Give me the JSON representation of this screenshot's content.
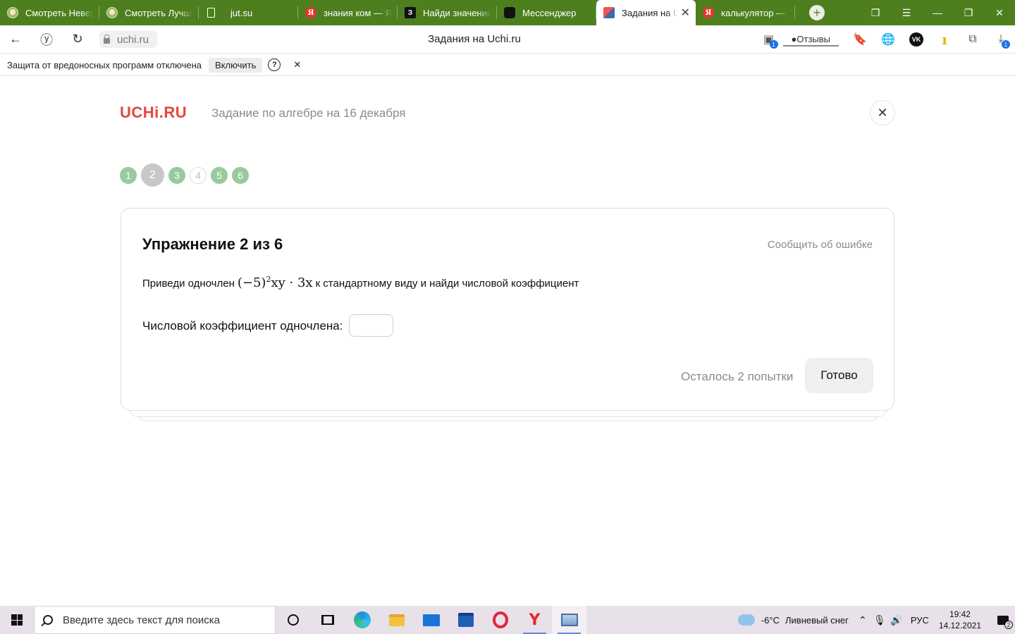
{
  "browser": {
    "tabs": [
      {
        "title": "Смотреть Невероятные",
        "icon": "film-icon",
        "active": false
      },
      {
        "title": "Смотреть Лучшие",
        "icon": "film-icon",
        "active": false
      },
      {
        "title": "jut.su",
        "icon": "document-icon",
        "active": false
      },
      {
        "title": "знания ком — Яндекс",
        "icon": "yandex-icon",
        "icon_text": "Я",
        "active": false
      },
      {
        "title": "Найди значение",
        "icon": "znanija-icon",
        "icon_text": "З",
        "active": false
      },
      {
        "title": "Мессенджер",
        "icon": "messenger-icon",
        "active": false
      },
      {
        "title": "Задания на Uchi.ru",
        "icon": "uchi-icon",
        "active": true
      },
      {
        "title": "калькулятор — Яндекс",
        "icon": "yandex-icon",
        "icon_text": "Я",
        "active": false
      }
    ],
    "new_tab_glyph": "+",
    "address": "uchi.ru",
    "page_title": "Задания на Uchi.ru",
    "reviews_label": "Отзывы",
    "downloads_badge": "1",
    "tab_count_badge": "1",
    "vk_label": "VK",
    "brand_accent": "#4d7f1e"
  },
  "protection_bar": {
    "message": "Защита от вредоносных программ отключена",
    "enable_label": "Включить",
    "help_glyph": "?",
    "close_glyph": "✕"
  },
  "page": {
    "logo": "UCHi.RU",
    "logo_color": "#e3473c",
    "task_title": "Задание по алгебре на 16 декабря",
    "steps": [
      {
        "label": "1",
        "state": "done"
      },
      {
        "label": "2",
        "state": "current"
      },
      {
        "label": "3",
        "state": "done"
      },
      {
        "label": "4",
        "state": "empty"
      },
      {
        "label": "5",
        "state": "done"
      },
      {
        "label": "6",
        "state": "done"
      }
    ],
    "exercise_title": "Упражнение 2 из 6",
    "report_link": "Сообщить об ошибке",
    "task_prefix": "Приведи одночлен",
    "math_base": "(−5)",
    "math_exp": "2",
    "math_rest": "xy · 3x",
    "task_suffix": "к стандартному виду и найди числовой коэффициент",
    "coef_label": "Числовой коэффициент одночлена:",
    "coef_value": "",
    "attempts_text": "Осталось 2 попытки",
    "done_label": "Готово",
    "step_done_color": "#98cb9b"
  },
  "taskbar": {
    "search_placeholder": "Введите здесь текст для поиска",
    "weather_temp": "-6°C",
    "weather_desc": "Ливневый снег",
    "language": "РУС",
    "time": "19:42",
    "date": "14.12.2021",
    "notifications_count": "2"
  }
}
